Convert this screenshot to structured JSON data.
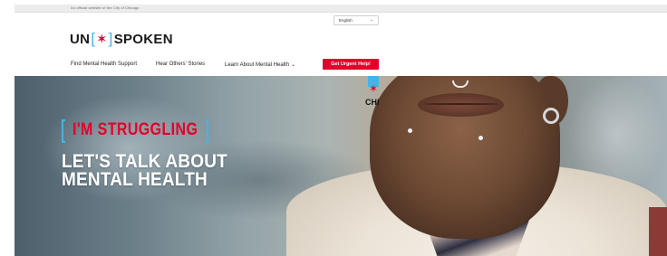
{
  "gov_banner": {
    "text": "An official website of the City of Chicago"
  },
  "language": {
    "selected": "English",
    "chevron_icon": "chevron-down-icon"
  },
  "logo": {
    "left": "UN",
    "bracket_open": "[",
    "star": "✶",
    "bracket_close": "]",
    "right": "SPOKEN"
  },
  "nav": {
    "items": [
      {
        "label": "Find Mental Health Support"
      },
      {
        "label": "Hear Others' Stories"
      },
      {
        "label": "Learn About Mental Health",
        "has_dropdown": true
      }
    ],
    "urgent_label": "Get Urgent Help!"
  },
  "hero": {
    "tagline": "I'M STRUGGLING",
    "headline_line1": "LET'S TALK ABOUT",
    "headline_line2": "MENTAL HEALTH",
    "pin_text": "CHI"
  },
  "colors": {
    "accent_red": "#e4002b",
    "accent_blue": "#41b6e6",
    "text_dark": "#1b1b1b"
  }
}
